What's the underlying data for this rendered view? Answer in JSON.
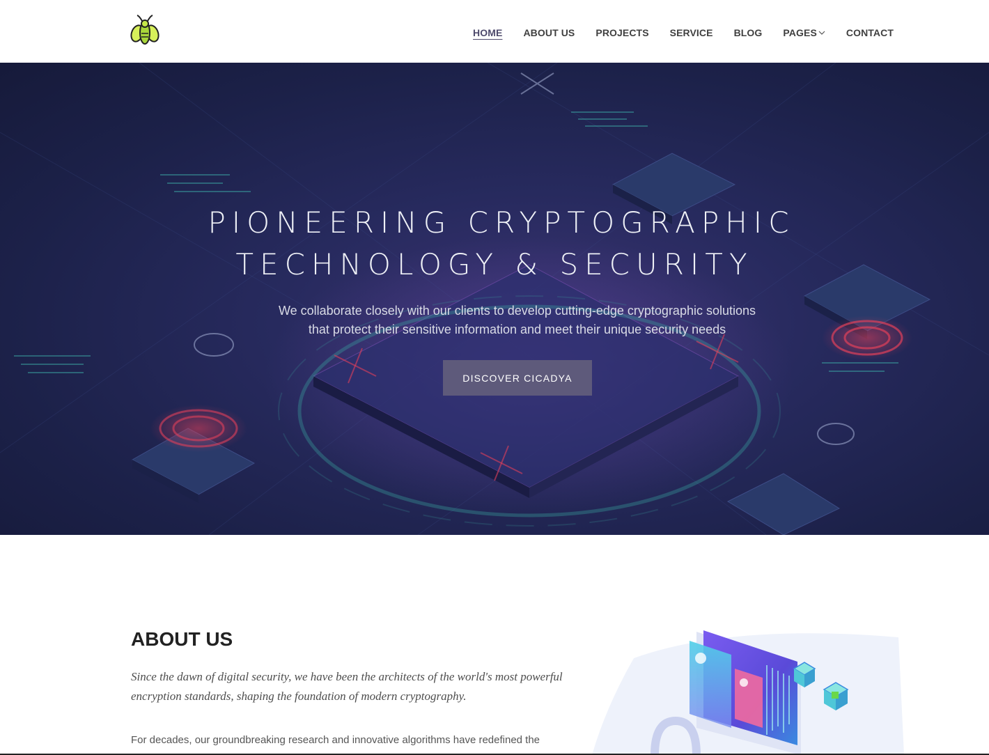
{
  "header": {
    "logo_icon": "cicada-icon",
    "nav": [
      {
        "label": "HOME",
        "active": true
      },
      {
        "label": "ABOUT US"
      },
      {
        "label": "PROJECTS"
      },
      {
        "label": "SERVICE"
      },
      {
        "label": "BLOG"
      },
      {
        "label": "PAGES",
        "has_dropdown": true
      },
      {
        "label": "CONTACT"
      }
    ]
  },
  "hero": {
    "title_line1": "PIONEERING CRYPTOGRAPHIC",
    "title_line2": "TECHNOLOGY & SECURITY",
    "subtitle_line1": "We collaborate closely with our clients to develop cutting-edge cryptographic solutions",
    "subtitle_line2": "that protect their sensitive information and meet their unique security needs",
    "cta_label": "DISCOVER CICADYA"
  },
  "about": {
    "title": "ABOUT US",
    "lead": "Since the dawn of digital security, we have been the architects of the world's most powerful encryption standards, shaping the foundation of modern cryptography.",
    "body": "For decades, our groundbreaking research and innovative algorithms have redefined the"
  },
  "colors": {
    "accent": "#5e5a7b",
    "nav_active": "#4e4a6c",
    "hero_bg": "#1c2149",
    "logo_green": "#c6e84a"
  }
}
